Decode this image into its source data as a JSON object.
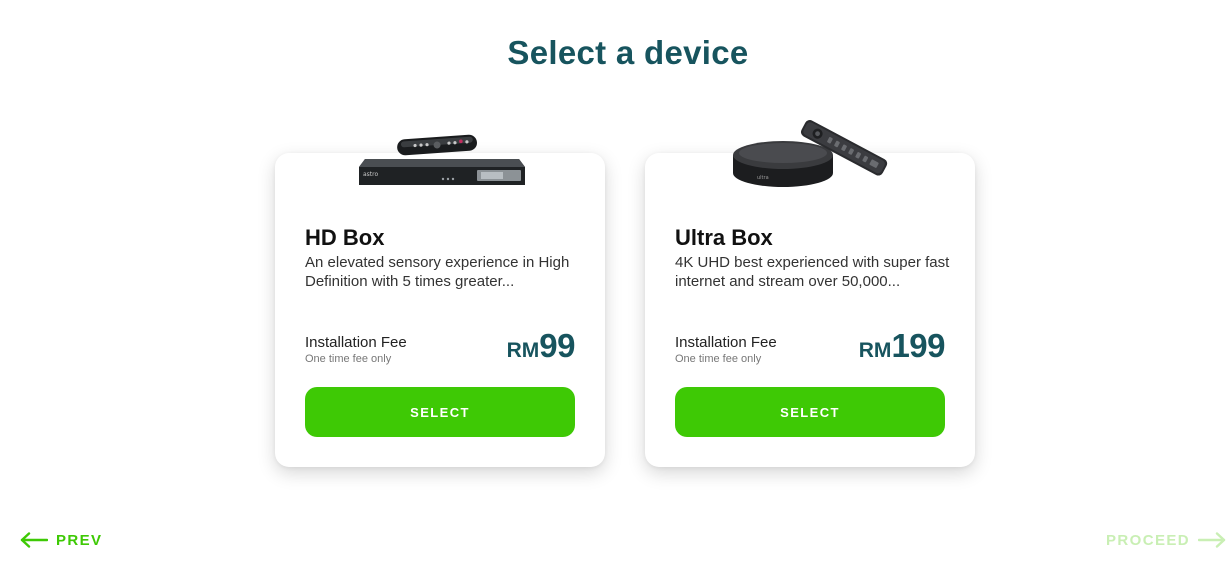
{
  "page": {
    "title": "Select a device"
  },
  "devices": [
    {
      "name": "HD Box",
      "description": "An elevated sensory experience in High Definition with 5 times greater...",
      "fee_label": "Installation Fee",
      "fee_note": "One time fee only",
      "currency": "RM",
      "price": "99",
      "button_label": "SELECT",
      "image_icon": "set-top-box-with-remote"
    },
    {
      "name": "Ultra Box",
      "description": "4K UHD best experienced with super fast internet and stream over 50,000...",
      "fee_label": "Installation Fee",
      "fee_note": "One time fee only",
      "currency": "RM",
      "price": "199",
      "button_label": "SELECT",
      "image_icon": "ultra-box-with-remote"
    }
  ],
  "navigation": {
    "prev_label": "PREV",
    "next_label": "PROCEED",
    "prev_icon": "arrow-left-icon",
    "next_icon": "arrow-right-icon"
  },
  "colors": {
    "heading": "#17545e",
    "accent_green": "#3ec905",
    "disabled_green": "#c9efb4",
    "card_bg": "#ffffff"
  }
}
